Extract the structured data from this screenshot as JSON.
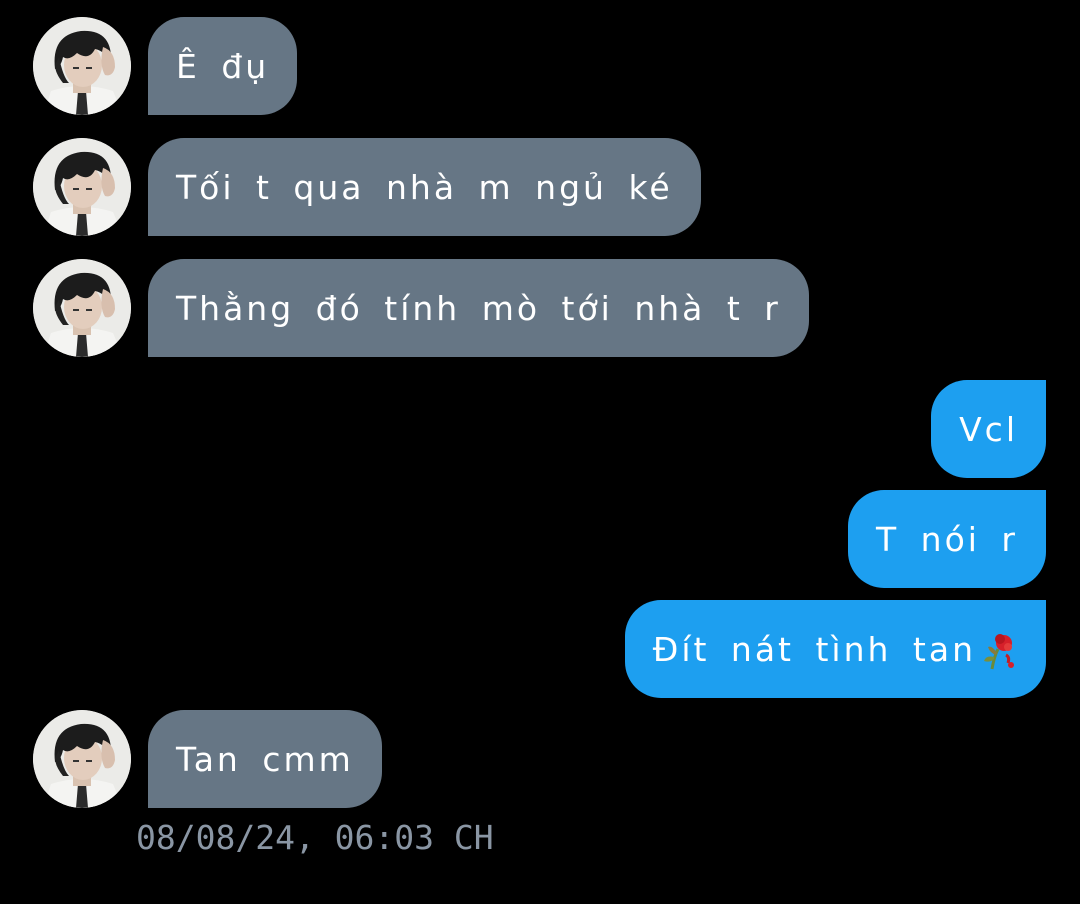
{
  "conversation": {
    "messages": [
      {
        "sender": "them",
        "text": "Ê đụ"
      },
      {
        "sender": "them",
        "text": "Tối t qua nhà m ngủ ké"
      },
      {
        "sender": "them",
        "text": "Thằng đó tính mò tới nhà t r"
      },
      {
        "sender": "me",
        "text": "Vcl"
      },
      {
        "sender": "me",
        "text": "T nói r"
      },
      {
        "sender": "me",
        "text": "Đít nát tình tan",
        "emoji": "wilted-rose"
      },
      {
        "sender": "them",
        "text": "Tan cmm"
      }
    ],
    "timestamp": "08/08/24, 06:03 CH"
  },
  "colors": {
    "background": "#000000",
    "incoming_bubble": "#667685",
    "outgoing_bubble": "#1d9ff0",
    "timestamp_text": "#8a96a4"
  }
}
